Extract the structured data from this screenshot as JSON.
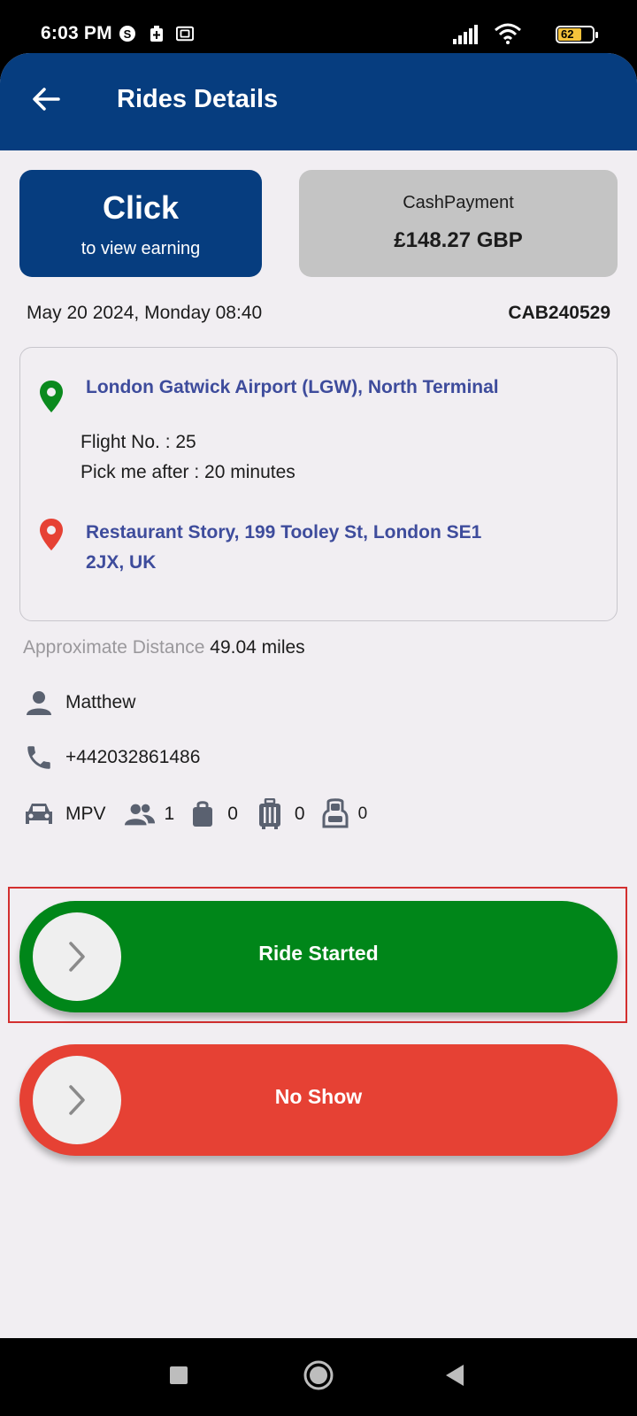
{
  "status_bar": {
    "time": "6:03 PM",
    "battery": "62",
    "icons": [
      "skype-icon",
      "medical-bag-icon",
      "wallet-icon",
      "signal-icon",
      "wifi-icon",
      "battery-icon"
    ]
  },
  "appbar": {
    "title": "Rides Details",
    "back_icon": "arrow-left-icon"
  },
  "earning_card": {
    "title": "Click",
    "subtitle": "to view earning"
  },
  "payment_card": {
    "type": "CashPayment",
    "amount": "£148.27 GBP"
  },
  "ride": {
    "datetime": "May 20 2024, Monday 08:40",
    "code": "CAB240529",
    "pickup": "London Gatwick Airport (LGW), North Terminal",
    "flight_no": "Flight No. : 25",
    "pick_after": "Pick me after : 20 minutes",
    "dropoff_line1": "Restaurant Story, 199 Tooley St, London SE1",
    "dropoff_line2": "2JX, UK",
    "distance_label": "Approximate Distance",
    "distance_value": "49.04 miles"
  },
  "passenger": {
    "name": "Matthew",
    "phone": "+442032861486"
  },
  "vehicle": {
    "type": "MPV",
    "passengers": "1",
    "bags": "0",
    "suitcases": "0",
    "child_seats": "0"
  },
  "actions": {
    "ride_started": "Ride Started",
    "no_show": "No Show"
  },
  "colors": {
    "primary": "#063d7f",
    "green": "#008619",
    "red": "#e64134",
    "link": "#3e4c9c"
  }
}
